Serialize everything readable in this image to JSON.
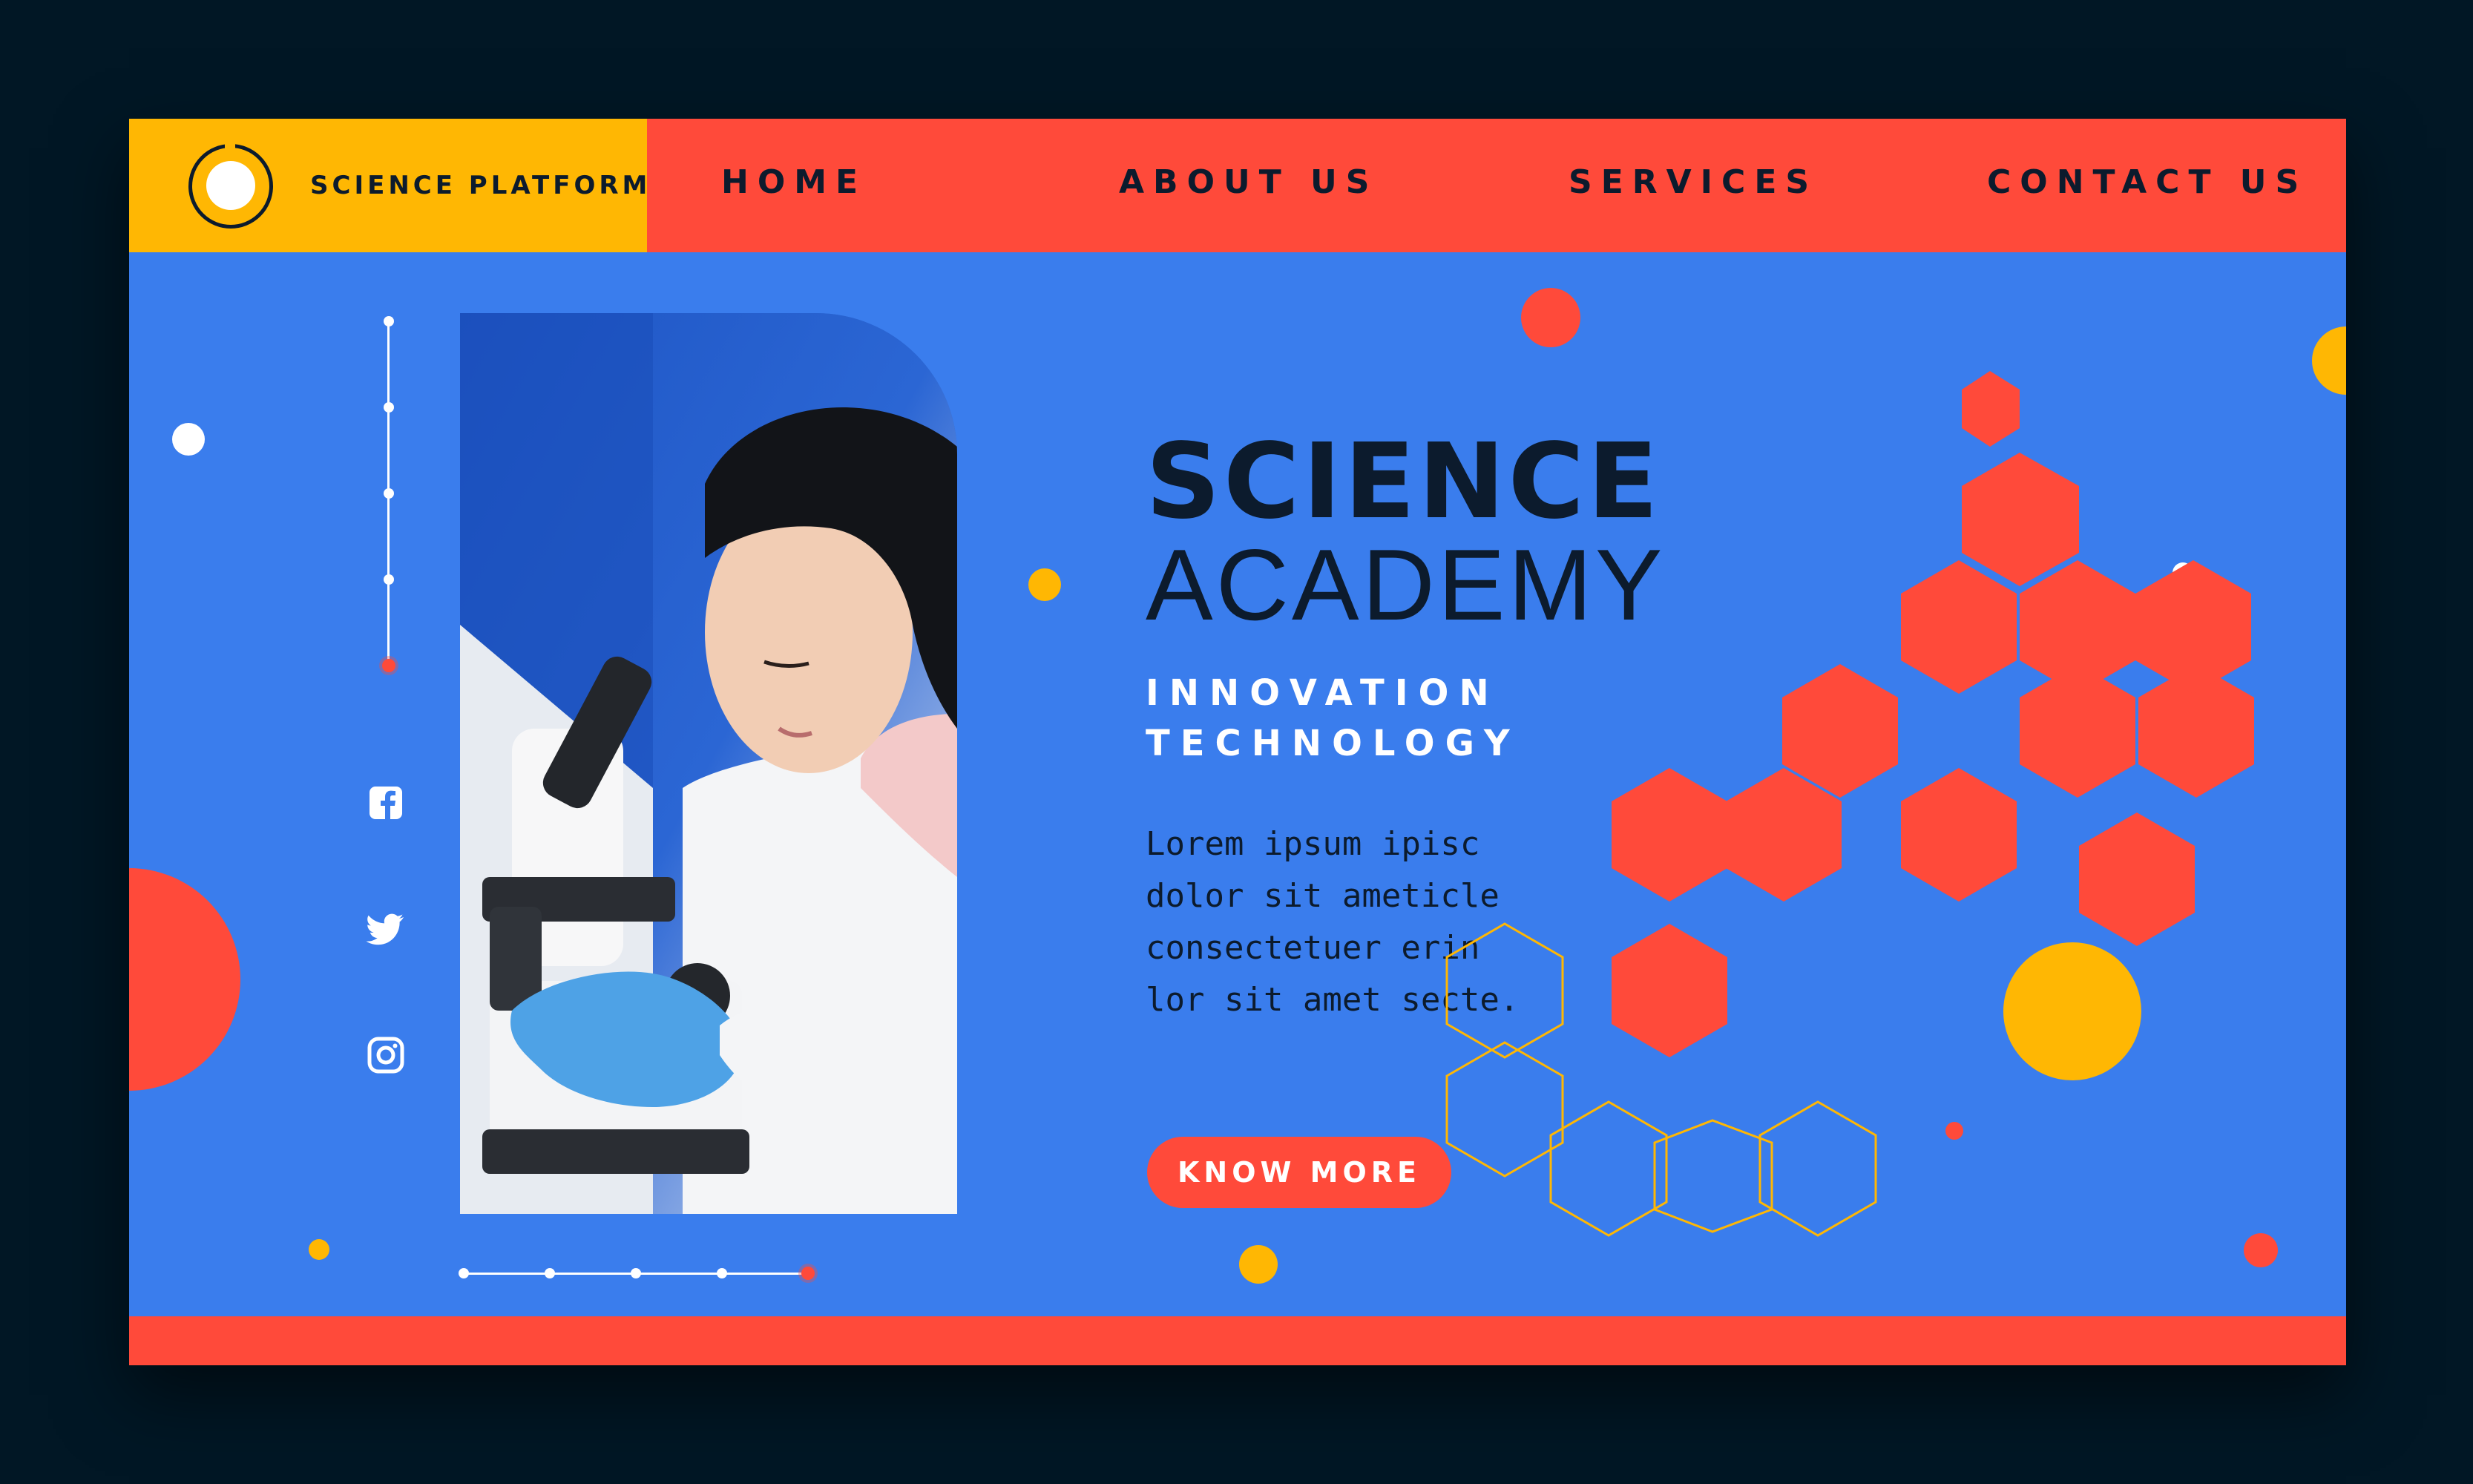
{
  "header": {
    "brand_name": "SCIENCE PLATFORM",
    "nav": [
      {
        "label": "HOME"
      },
      {
        "label": "ABOUT US"
      },
      {
        "label": "SERVICES"
      },
      {
        "label": "CONTACT US"
      }
    ]
  },
  "hero": {
    "title_strong": "SCIENCE",
    "title_light": "ACADEMY",
    "tagline": [
      "INNOVATION",
      "TECHNOLOGY"
    ],
    "body_lines": [
      "Lorem ipsum ipisc",
      "dolor sit ameticle",
      "consectetuer erin",
      "lor sit amet secte."
    ],
    "cta_label": "KNOW MORE"
  },
  "social": [
    {
      "icon": "facebook-icon"
    },
    {
      "icon": "twitter-icon"
    },
    {
      "icon": "instagram-icon"
    }
  ],
  "colors": {
    "background": "#011725",
    "canvas": "#3a7ded",
    "accent_red": "#ff4a3a",
    "accent_yellow": "#ffb703",
    "ink": "#0c1b2d",
    "white": "#ffffff"
  }
}
